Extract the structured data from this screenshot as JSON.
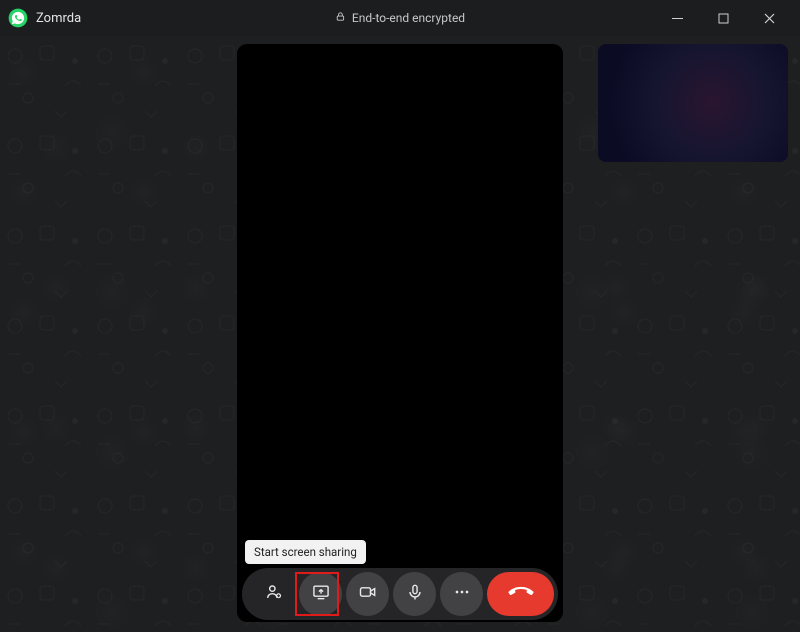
{
  "titlebar": {
    "contact_name": "Zomrda",
    "encrypted_label": "End-to-end encrypted"
  },
  "tooltip": {
    "screen_share": "Start screen sharing"
  },
  "icons": {
    "logo": "whatsapp",
    "lock": "lock",
    "minimize": "minimize",
    "maximize": "maximize",
    "close": "close",
    "add_participant": "person-add",
    "screen_share": "screen-share",
    "video": "video",
    "mic": "microphone",
    "more": "more-horizontal",
    "hangup": "phone-hangup"
  },
  "colors": {
    "window_bg": "#1c1d1f",
    "content_bg": "#1e1f21",
    "video_black": "#000000",
    "hangup_red": "#e63a2e",
    "highlight_red": "#e11b1b",
    "tooltip_bg": "#f2f2f2",
    "whatsapp_green": "#25D366"
  }
}
